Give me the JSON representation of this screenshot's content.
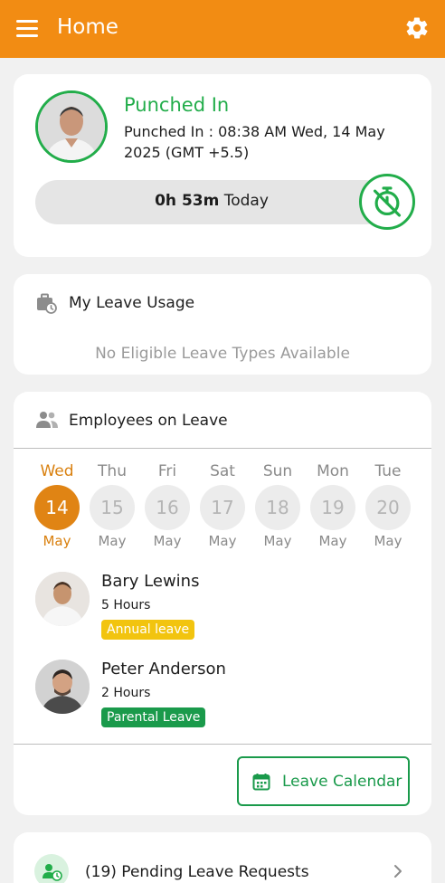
{
  "header": {
    "title": "Home",
    "menu_icon": "menu-icon",
    "settings_icon": "gear-icon",
    "bg_color": "#f28c13"
  },
  "punch": {
    "status": "Punched In",
    "detail": "Punched In : 08:38 AM Wed, 14 May 2025 (GMT +5.5)",
    "duration": "0h 53m",
    "duration_suffix": "Today",
    "status_color": "#22ad4a",
    "action_icon": "stopwatch-off-icon"
  },
  "leave_usage": {
    "title": "My Leave Usage",
    "icon": "briefcase-clock-icon",
    "empty_message": "No Eligible Leave Types Available"
  },
  "employees_on_leave": {
    "title": "Employees on Leave",
    "icon": "people-icon",
    "days": [
      {
        "name": "Wed",
        "date": "14",
        "month": "May",
        "selected": true
      },
      {
        "name": "Thu",
        "date": "15",
        "month": "May",
        "selected": false
      },
      {
        "name": "Fri",
        "date": "16",
        "month": "May",
        "selected": false
      },
      {
        "name": "Sat",
        "date": "17",
        "month": "May",
        "selected": false
      },
      {
        "name": "Sun",
        "date": "18",
        "month": "May",
        "selected": false
      },
      {
        "name": "Mon",
        "date": "19",
        "month": "May",
        "selected": false
      },
      {
        "name": "Tue",
        "date": "20",
        "month": "May",
        "selected": false
      }
    ],
    "employees": [
      {
        "name": "Bary Lewins",
        "hours": "5 Hours",
        "leave_type": "Annual leave",
        "badge_color": "#f2c40f"
      },
      {
        "name": "Peter Anderson",
        "hours": "2 Hours",
        "leave_type": "Parental Leave",
        "badge_color": "#1a9a4b"
      }
    ],
    "calendar_button": "Leave Calendar",
    "calendar_icon": "calendar-icon"
  },
  "pending": {
    "label": "(19) Pending Leave Requests",
    "icon": "pending-person-icon",
    "chevron_icon": "chevron-right-icon"
  }
}
